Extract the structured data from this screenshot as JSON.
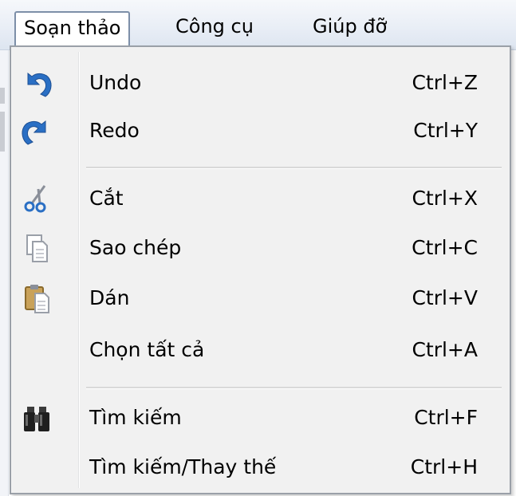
{
  "menubar": {
    "menus": [
      {
        "label": "Soạn thảo",
        "active": true
      },
      {
        "label": "Công cụ",
        "active": false
      },
      {
        "label": "Giúp đỡ",
        "active": false
      }
    ]
  },
  "dropdown": {
    "items": [
      {
        "label": "Undo",
        "shortcut": "Ctrl+Z",
        "icon": "undo-icon"
      },
      {
        "label": "Redo",
        "shortcut": "Ctrl+Y",
        "icon": "redo-icon"
      },
      {
        "label": "Cắt",
        "shortcut": "Ctrl+X",
        "icon": "scissors-icon"
      },
      {
        "label": "Sao chép",
        "shortcut": "Ctrl+C",
        "icon": "copy-icon"
      },
      {
        "label": "Dán",
        "shortcut": "Ctrl+V",
        "icon": "paste-icon"
      },
      {
        "label": "Chọn tất cả",
        "shortcut": "Ctrl+A",
        "icon": ""
      },
      {
        "label": "Tìm kiếm",
        "shortcut": "Ctrl+F",
        "icon": "binoculars-icon"
      },
      {
        "label": "Tìm kiếm/Thay thế",
        "shortcut": "Ctrl+H",
        "icon": ""
      }
    ]
  },
  "colors": {
    "menubar_bg": "#e9eef6",
    "dropdown_bg": "#f1f1f1",
    "icon_blue": "#2a6fc4"
  }
}
